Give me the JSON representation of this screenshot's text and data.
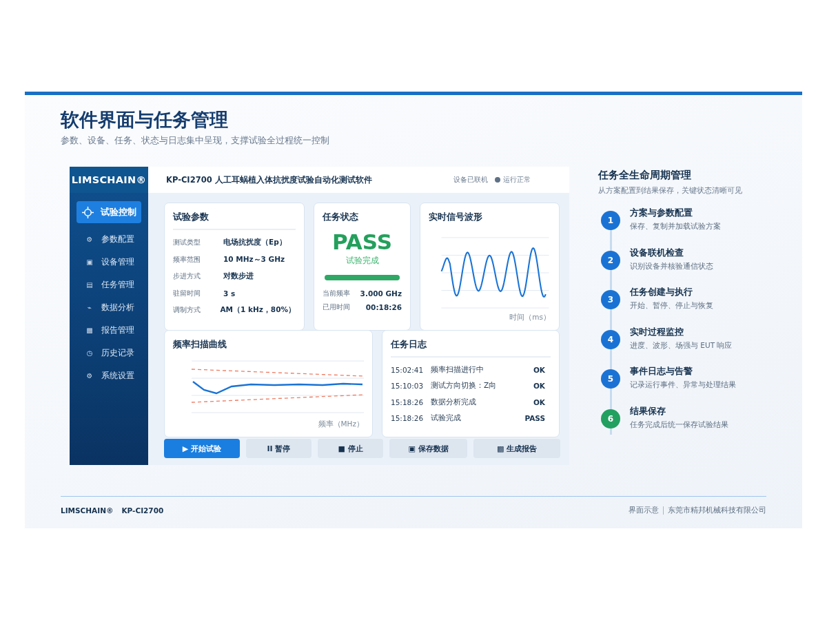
{
  "slide": {
    "title": "软件界面与任务管理",
    "subtitle": "参数、设备、任务、状态与日志集中呈现，支撑试验全过程统一控制"
  },
  "app": {
    "logo": "LIMSCHAIN®",
    "title": "KP-CI2700 人工耳蜗植入体抗扰度试验自动化测试软件",
    "status_device": "设备已联机",
    "status_run": "运行正常",
    "nav": [
      {
        "label": "试验控制",
        "selected": true
      },
      {
        "glyph": "⚙",
        "label": "参数配置",
        "selected": false
      },
      {
        "glyph": "▣",
        "label": "设备管理",
        "selected": false
      },
      {
        "glyph": "▤",
        "label": "任务管理",
        "selected": false
      },
      {
        "glyph": "⌁",
        "label": "数据分析",
        "selected": false
      },
      {
        "glyph": "▩",
        "label": "报告管理",
        "selected": false
      },
      {
        "glyph": "◷",
        "label": "历史记录",
        "selected": false
      },
      {
        "glyph": "⚙",
        "label": "系统设置",
        "selected": false
      }
    ],
    "params": {
      "title": "试验参数",
      "rows": [
        {
          "label": "测试类型",
          "value": "电场抗扰度（Ep）"
        },
        {
          "label": "频率范围",
          "value": "10 MHz～3 GHz"
        },
        {
          "label": "步进方式",
          "value": "对数步进"
        },
        {
          "label": "驻留时间",
          "value": "3 s"
        },
        {
          "label": "调制方式",
          "value": "AM（1 kHz，80%）"
        }
      ]
    },
    "task_status": {
      "title": "任务状态",
      "result": "PASS",
      "result_note": "试验完成",
      "level": 1,
      "rows": [
        {
          "label": "当前频率",
          "value": "3.000 GHz"
        },
        {
          "label": "已用时间",
          "value": "00:18:26"
        }
      ]
    },
    "waveform": {
      "title": "实时信号波形",
      "axis_label": "时间（ms）"
    },
    "sweep": {
      "title": "频率扫描曲线",
      "axis_label": "频率（MHz）"
    },
    "log": {
      "title": "任务日志",
      "rows": [
        {
          "time": "15:02:41",
          "event": "频率扫描进行中",
          "result": "OK"
        },
        {
          "time": "15:10:03",
          "event": "测试方向切换：Z向",
          "result": "OK"
        },
        {
          "time": "15:18:26",
          "event": "数据分析完成",
          "result": "OK"
        },
        {
          "time": "15:18:26",
          "event": "试验完成",
          "result": "PASS"
        }
      ]
    },
    "buttons": [
      {
        "label": "▶ 开始试验",
        "kind": "primary"
      },
      {
        "label": "II 暂停",
        "kind": "secondary"
      },
      {
        "label": "■ 停止",
        "kind": "secondary"
      },
      {
        "label": "▣ 保存数据",
        "kind": "secondary"
      },
      {
        "label": "▩ 生成报告",
        "kind": "secondary"
      }
    ]
  },
  "lifecycle": {
    "title": "任务全生命周期管理",
    "subtitle": "从方案配置到结果保存，关键状态清晰可见",
    "steps": [
      {
        "number": "1",
        "title": "方案与参数配置",
        "desc": "保存、复制并加载试验方案",
        "color": "#1a73d4"
      },
      {
        "number": "2",
        "title": "设备联机检查",
        "desc": "识别设备并核验通信状态",
        "color": "#1a73d4"
      },
      {
        "number": "3",
        "title": "任务创建与执行",
        "desc": "开始、暂停、停止与恢复",
        "color": "#1a73d4"
      },
      {
        "number": "4",
        "title": "实时过程监控",
        "desc": "进度、波形、场强与 EUT 响应",
        "color": "#1a73d4"
      },
      {
        "number": "5",
        "title": "事件日志与告警",
        "desc": "记录运行事件、异常与处理结果",
        "color": "#1a73d4"
      },
      {
        "number": "6",
        "title": "结果保存",
        "desc": "任务完成后统一保存试验结果",
        "color": "#22a060"
      }
    ]
  },
  "footer": {
    "brand": "LIMSCHAIN®",
    "model": "KP-CI2700",
    "note": "界面示意",
    "company": "东莞市精邦机械科技有限公司"
  }
}
